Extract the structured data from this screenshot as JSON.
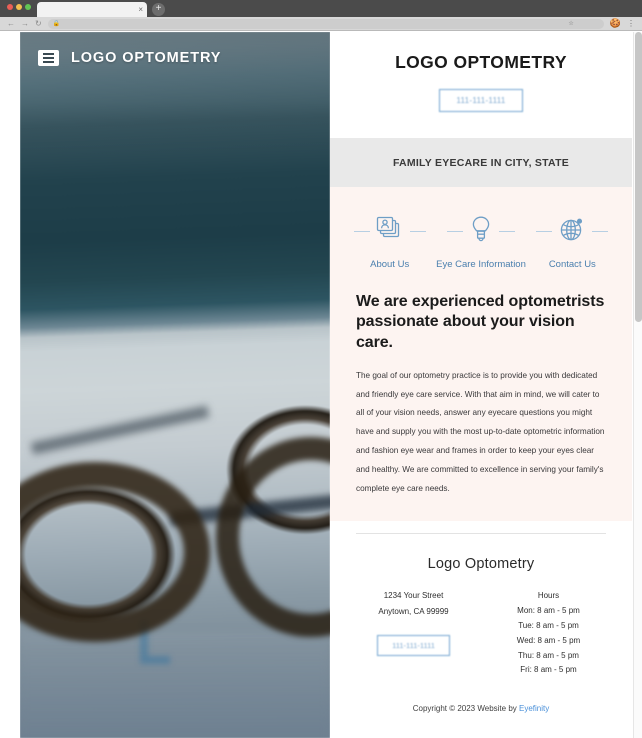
{
  "browser": {
    "tab_title": "",
    "tab_close_label": "×",
    "new_tab_label": "+",
    "back_label": "←",
    "forward_label": "→",
    "reload_label": "↻",
    "url_value": "",
    "url_placeholder": "",
    "lock_icon": "ὑ2",
    "star_label": "☆",
    "menu_label": "⋮"
  },
  "hero": {
    "logo_text": "LOGO OPTOMETRY",
    "menu_icon_name": "hamburger-menu-icon"
  },
  "header": {
    "brand_title": "LOGO OPTOMETRY",
    "phone": "111-111-1111"
  },
  "eyebrow": {
    "text": "FAMILY EYECARE IN CITY, STATE"
  },
  "quicklinks": [
    {
      "label": "About Us",
      "icon": "id-cards-icon"
    },
    {
      "label": "Eye Care Information",
      "icon": "lightbulb-icon"
    },
    {
      "label": "Contact Us",
      "icon": "globe-icon"
    }
  ],
  "intro": {
    "headline": "We are experienced optometrists passionate about your vision care.",
    "body": "The goal of our optometry practice is to provide you with dedicated and friendly eye care service. With that aim in mind, we will cater to all of your vision needs, answer any eyecare questions you might have and supply you with the most up-to-date optometric information and fashion eye wear and frames in order to keep your eyes clear and healthy. We are committed to excellence in serving your family's complete eye care needs."
  },
  "footer": {
    "brand": "Logo Optometry",
    "address_line1": "1234 Your Street",
    "address_line2": "Anytown, CA  99999",
    "phone": "111-111-1111",
    "hours_heading": "Hours",
    "hours": [
      "Mon: 8 am - 5 pm",
      "Tue: 8 am - 5 pm",
      "Wed: 8 am - 5 pm",
      "Thu: 8 am - 5 pm",
      "Fri: 8 am - 5 pm"
    ],
    "copyright_text": "Copyright © 2023  Website by ",
    "copyright_link": "Eyefinity"
  },
  "colors": {
    "accent_blue": "#4a7fae",
    "link_blue": "#4a90d9",
    "pink_panel": "#fdf4f1",
    "gray_panel": "#e9e9e9"
  }
}
